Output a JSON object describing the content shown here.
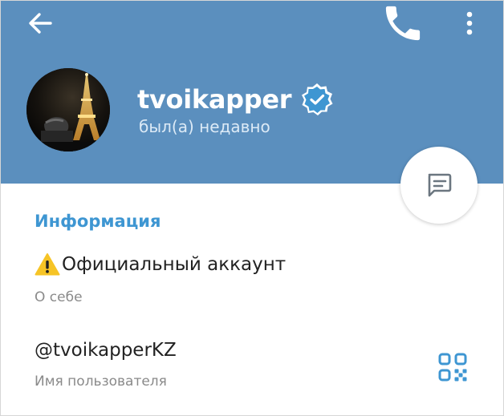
{
  "header": {
    "back_icon": "arrow-left-icon",
    "call_icon": "phone-icon",
    "menu_icon": "more-vertical-icon",
    "background_color": "#5b8fbe"
  },
  "profile": {
    "name": "tvoikapper",
    "status": "был(а) недавно",
    "verified": true,
    "verified_icon": "verified-badge-icon",
    "avatar_icon": "avatar-photo"
  },
  "fab": {
    "icon": "message-icon"
  },
  "info": {
    "section_title": "Информация",
    "bio_icon": "warning-icon",
    "bio": "Официальный аккаунт",
    "bio_caption": "О себе",
    "username": "@tvoikapperKZ",
    "username_caption": "Имя пользователя",
    "qr_icon": "qr-code-icon"
  },
  "colors": {
    "accent": "#3e96d2",
    "header": "#5b8fbe",
    "secondary_text": "#8a8a8a"
  }
}
